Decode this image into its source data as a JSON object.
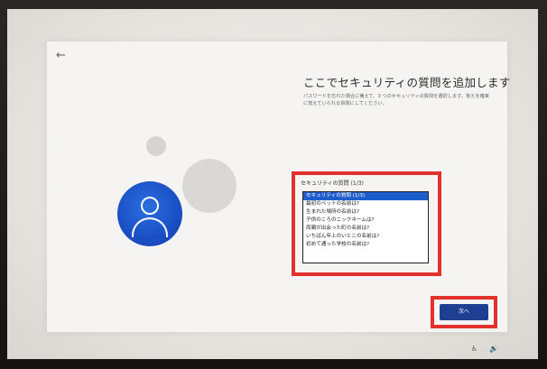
{
  "panel": {
    "back_icon": "←",
    "title": "ここでセキュリティの質問を追加します",
    "description": "パスワードを忘れた場合に備えて、3 つのセキュリティの質問を選択します。答えを確実に覚えていられる質問にしてください。"
  },
  "security": {
    "label": "セキュリティの質問 (1/3)",
    "selected_value": "セキュリティの質問 (1/3)",
    "options": [
      "セキュリティの質問 (1/3)",
      "最初のペットの名前は?",
      "生まれた場所の名前は?",
      "子供のころのニックネームは?",
      "両親が出会った町の名前は?",
      "いちばん年上のいとこの名前は?",
      "初めて通った学校の名前は?"
    ]
  },
  "footer": {
    "next_label": "次へ"
  },
  "tray": {
    "accessibility_icon": "♿",
    "volume_icon": "🔊"
  },
  "colors": {
    "accent": "#1e5dcc",
    "highlight_box": "#e3322e",
    "next_button": "#1f3f93",
    "avatar": "#1a4fc4"
  }
}
